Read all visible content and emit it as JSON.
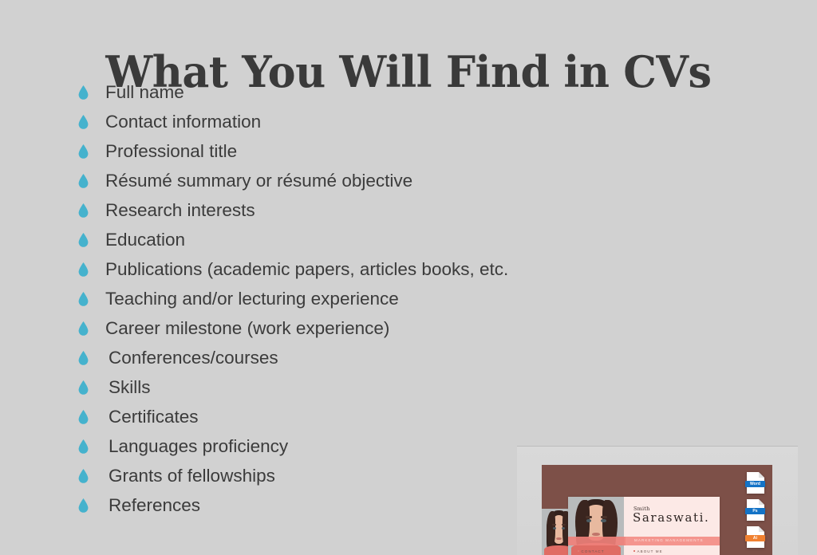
{
  "slide": {
    "title": "What You Will Find in CVs",
    "background_color": "#d1d1d1",
    "text_color": "#3a3a3a",
    "bullet_color": "#45b2cd"
  },
  "bullets": [
    {
      "icon": "water-drop-bullet-icon",
      "label": "Full name"
    },
    {
      "icon": "water-drop-bullet-icon",
      "label": "Contact information"
    },
    {
      "icon": "water-drop-bullet-icon",
      "label": "Professional title"
    },
    {
      "icon": "water-drop-bullet-icon",
      "label": "Résumé summary or résumé objective"
    },
    {
      "icon": "water-drop-bullet-icon",
      "label": "Research interests"
    },
    {
      "icon": "water-drop-bullet-icon",
      "label": "Education"
    },
    {
      "icon": "water-drop-bullet-icon",
      "label": "Publications (academic papers, articles books, etc."
    },
    {
      "icon": "water-drop-bullet-icon",
      "label": "Teaching and/or lecturing experience"
    },
    {
      "icon": "water-drop-bullet-icon",
      "label": "Career milestone (work experience)"
    },
    {
      "icon": "water-drop-bullet-icon",
      "label": "Conferences/courses"
    },
    {
      "icon": "water-drop-bullet-icon",
      "label": "Skills"
    },
    {
      "icon": "water-drop-bullet-icon",
      "label": "Certificates"
    },
    {
      "icon": "water-drop-bullet-icon",
      "label": "Languages proficiency"
    },
    {
      "icon": "water-drop-bullet-icon",
      "label": "Grants of fellowships"
    },
    {
      "icon": "water-drop-bullet-icon",
      "label": "References"
    }
  ],
  "preview": {
    "card_color": "#7d5048",
    "accent_color": "#f4958e",
    "paper_color": "#fce9e6",
    "first_name": "Smith",
    "last_name": "Saraswati.",
    "role": "MARKETING MANAGEMENTS",
    "section_contact": "CONTACT",
    "section_about": "ABOUT ME",
    "file_chips": [
      {
        "label": "Word",
        "color": "#1473c6"
      },
      {
        "label": "Ps",
        "color": "#1473c6"
      },
      {
        "label": "Ai",
        "color": "#f08030"
      }
    ]
  }
}
